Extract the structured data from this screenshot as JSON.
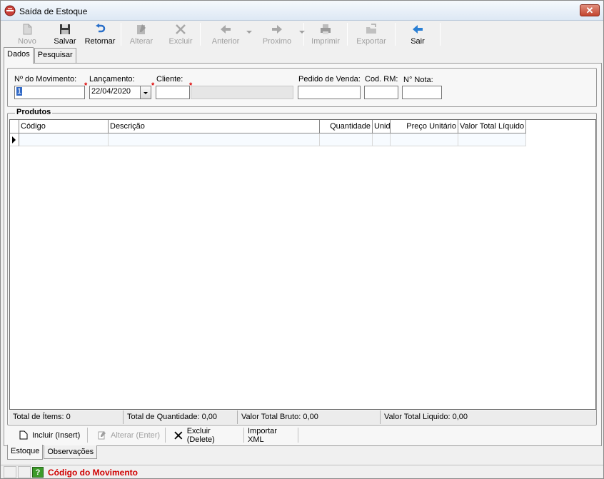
{
  "window": {
    "title": "Saída de Estoque",
    "close_label": "✕"
  },
  "toolbar": {
    "novo": "Novo",
    "salvar": "Salvar",
    "retornar": "Retornar",
    "alterar": "Alterar",
    "excluir": "Excluir",
    "anterior": "Anterior",
    "proximo": "Proximo",
    "imprimir": "Imprimir",
    "exportar": "Exportar",
    "sair": "Sair"
  },
  "tabs": {
    "dados": "Dados",
    "pesquisar": "Pesquisar"
  },
  "header": {
    "movimento_label": "Nº do Movimento:",
    "movimento_value": "1",
    "lancamento_label": "Lançamento:",
    "lancamento_value": "22/04/2020",
    "cliente_label": "Cliente:",
    "cliente_code": "",
    "cliente_name": "",
    "pedido_label": "Pedido de Venda:",
    "pedido_value": "",
    "codrm_label": "Cod. RM:",
    "codrm_value": "",
    "nota_label": "N° Nota:",
    "nota_value": "",
    "required_mark": "*"
  },
  "produtos": {
    "title": "Produtos",
    "columns": [
      "Código",
      "Descrição",
      "Quantidade",
      "Unid",
      "Preço Unitário",
      "Valor Total Líquido"
    ]
  },
  "totals": {
    "items": "Total de Ítems: 0",
    "quantidade": "Total de Quantidade: 0,00",
    "bruto": "Valor Total Bruto: 0,00",
    "liquido": "Valor Total Liquido: 0,00"
  },
  "actions": {
    "incluir": "Incluir (Insert)",
    "alterar": "Alterar (Enter)",
    "excluir": "Excluir (Delete)",
    "importar": "Importar XML"
  },
  "bottom_tabs": {
    "estoque": "Estoque",
    "observacoes": "Observações"
  },
  "status": {
    "help_icon": "?",
    "text": "Código do Movimento"
  }
}
